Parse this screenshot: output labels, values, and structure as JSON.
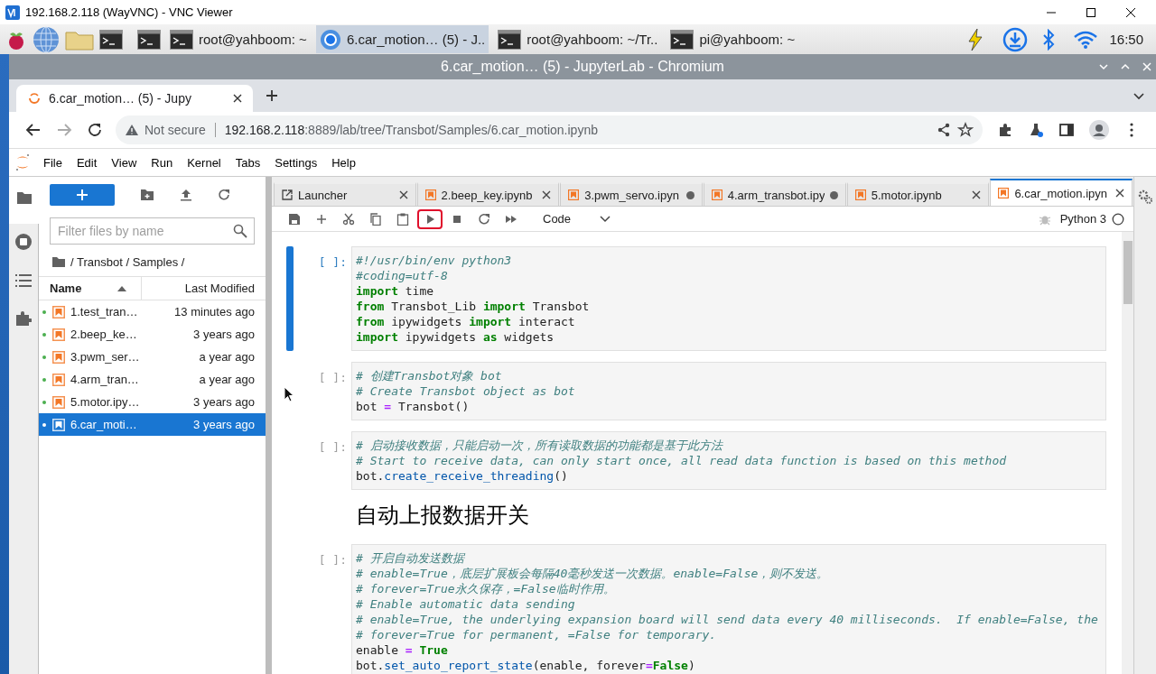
{
  "vnc_window": {
    "title": "192.168.2.118 (WayVNC) - VNC Viewer"
  },
  "taskbar": {
    "tasks": [
      {
        "label": "root@yahboom: ~",
        "kind": "terminal",
        "selected": false
      },
      {
        "label": "6.car_motion… (5) - J..",
        "kind": "browser",
        "selected": true
      },
      {
        "label": "root@yahboom: ~/Tr..",
        "kind": "terminal",
        "selected": false
      },
      {
        "label": "pi@yahboom: ~",
        "kind": "terminal",
        "selected": false
      }
    ],
    "clock": "16:50"
  },
  "browser": {
    "title": "6.car_motion… (5) - JupyterLab - Chromium",
    "tab_title": "6.car_motion… (5) - Jupy",
    "security": "Not secure",
    "url_host": "192.168.2.118",
    "url_rest": ":8889/lab/tree/Transbot/Samples/6.car_motion.ipynb"
  },
  "menu": [
    "File",
    "Edit",
    "View",
    "Run",
    "Kernel",
    "Tabs",
    "Settings",
    "Help"
  ],
  "file_browser": {
    "filter_placeholder": "Filter files by name",
    "breadcrumb": "/ Transbot / Samples /",
    "columns": [
      {
        "label": "Name",
        "sorted": true
      },
      {
        "label": "Last Modified",
        "sorted": false
      }
    ],
    "files": [
      {
        "name": "1.test_tran…",
        "modified": "13 minutes ago",
        "running": true,
        "selected": false
      },
      {
        "name": "2.beep_ke…",
        "modified": "3 years ago",
        "running": true,
        "selected": false
      },
      {
        "name": "3.pwm_ser…",
        "modified": "a year ago",
        "running": true,
        "selected": false
      },
      {
        "name": "4.arm_tran…",
        "modified": "a year ago",
        "running": true,
        "selected": false
      },
      {
        "name": "5.motor.ipy…",
        "modified": "3 years ago",
        "running": true,
        "selected": false
      },
      {
        "name": "6.car_moti…",
        "modified": "3 years ago",
        "running": true,
        "selected": true
      }
    ]
  },
  "notebook": {
    "tabs": [
      {
        "label": "Launcher",
        "kind": "launcher",
        "dirty": false,
        "selected": false
      },
      {
        "label": "2.beep_key.ipynb",
        "kind": "notebook",
        "dirty": false,
        "selected": false
      },
      {
        "label": "3.pwm_servo.ipyn",
        "kind": "notebook",
        "dirty": true,
        "selected": false
      },
      {
        "label": "4.arm_transbot.ipy",
        "kind": "notebook",
        "dirty": true,
        "selected": false
      },
      {
        "label": "5.motor.ipynb",
        "kind": "notebook",
        "dirty": false,
        "selected": false
      },
      {
        "label": "6.car_motion.ipyn",
        "kind": "notebook",
        "dirty": false,
        "selected": true
      }
    ],
    "toolbar": {
      "tools": [
        {
          "kind": "save",
          "highlighted": false
        },
        {
          "kind": "add",
          "highlighted": false
        },
        {
          "kind": "cut",
          "highlighted": false
        },
        {
          "kind": "copy",
          "highlighted": false
        },
        {
          "kind": "paste",
          "highlighted": false
        },
        {
          "kind": "run",
          "highlighted": true
        },
        {
          "kind": "stop",
          "highlighted": false
        },
        {
          "kind": "restart",
          "highlighted": false
        },
        {
          "kind": "fast-forward",
          "highlighted": false
        }
      ],
      "cell_type": "Code",
      "kernel": "Python 3",
      "kernel_busy": false
    },
    "cells": [
      {
        "kind": "code",
        "prompt": "[ ]:",
        "active": true,
        "lines": [
          [
            {
              "kind": "comment",
              "text": "#!/usr/bin/env python3"
            }
          ],
          [
            {
              "kind": "comment",
              "text": "#coding=utf-8"
            }
          ],
          [
            {
              "kind": "keyword",
              "text": "import"
            },
            {
              "kind": "name",
              "text": " time"
            }
          ],
          [
            {
              "kind": "keyword",
              "text": "from"
            },
            {
              "kind": "name",
              "text": " Transbot_Lib "
            },
            {
              "kind": "keyword",
              "text": "import"
            },
            {
              "kind": "name",
              "text": " Transbot"
            }
          ],
          [
            {
              "kind": "keyword",
              "text": "from"
            },
            {
              "kind": "name",
              "text": " ipywidgets "
            },
            {
              "kind": "keyword",
              "text": "import"
            },
            {
              "kind": "name",
              "text": " interact"
            }
          ],
          [
            {
              "kind": "keyword",
              "text": "import"
            },
            {
              "kind": "name",
              "text": " ipywidgets "
            },
            {
              "kind": "keyword",
              "text": "as"
            },
            {
              "kind": "name",
              "text": " widgets"
            }
          ]
        ]
      },
      {
        "kind": "code",
        "prompt": "[ ]:",
        "active": false,
        "lines": [
          [
            {
              "kind": "comment",
              "text": "# 创建Transbot对象 bot"
            }
          ],
          [
            {
              "kind": "comment",
              "text": "# Create Transbot object as bot"
            }
          ],
          [
            {
              "kind": "name",
              "text": "bot "
            },
            {
              "kind": "operator",
              "text": "="
            },
            {
              "kind": "name",
              "text": " Transbot()"
            }
          ]
        ]
      },
      {
        "kind": "code",
        "prompt": "[ ]:",
        "active": false,
        "lines": [
          [
            {
              "kind": "comment",
              "text": "# 启动接收数据，只能启动一次，所有读取数据的功能都是基于此方法"
            }
          ],
          [
            {
              "kind": "comment",
              "text": "# Start to receive data, can only start once, all read data function is based on this method"
            }
          ],
          [
            {
              "kind": "name",
              "text": "bot."
            },
            {
              "kind": "function",
              "text": "create_receive_threading"
            },
            {
              "kind": "name",
              "text": "()"
            }
          ]
        ]
      },
      {
        "kind": "markdown",
        "heading": "自动上报数据开关"
      },
      {
        "kind": "code",
        "prompt": "[ ]:",
        "active": false,
        "lines": [
          [
            {
              "kind": "comment",
              "text": "# 开启自动发送数据"
            }
          ],
          [
            {
              "kind": "comment",
              "text": "# enable=True，底层扩展板会每隔40毫秒发送一次数据。enable=False，则不发送。"
            }
          ],
          [
            {
              "kind": "comment",
              "text": "# forever=True永久保存，=False临时作用。"
            }
          ],
          [
            {
              "kind": "comment",
              "text": "# Enable automatic data sending"
            }
          ],
          [
            {
              "kind": "comment",
              "text": "# enable=True, the underlying expansion board will send data every 40 milliseconds.  If enable=False, the"
            }
          ],
          [
            {
              "kind": "comment",
              "text": "# forever=True for permanent, =False for temporary."
            }
          ],
          [
            {
              "kind": "name",
              "text": "enable "
            },
            {
              "kind": "operator",
              "text": "= "
            },
            {
              "kind": "keyword",
              "text": "True"
            }
          ],
          [
            {
              "kind": "name",
              "text": "bot."
            },
            {
              "kind": "function",
              "text": "set_auto_report_state"
            },
            {
              "kind": "name",
              "text": "(enable, forever"
            },
            {
              "kind": "operator",
              "text": "="
            },
            {
              "kind": "keyword",
              "text": "False"
            },
            {
              "kind": "name",
              "text": ")"
            }
          ]
        ]
      }
    ]
  }
}
